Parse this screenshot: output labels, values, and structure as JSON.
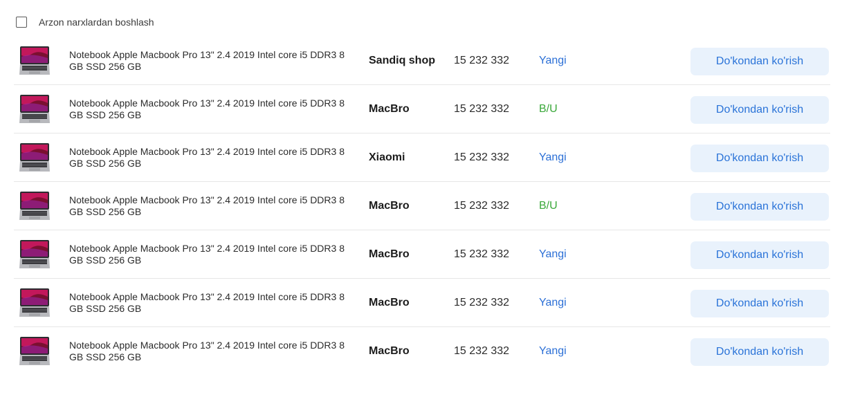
{
  "filter": {
    "label": "Arzon narxlardan boshlash",
    "checked": false
  },
  "colors": {
    "new_condition": "#2b6fd6",
    "used_condition": "#3aa83a",
    "button_bg": "#e9f2fc",
    "button_text": "#2a73d8",
    "divider": "#e6e6e6"
  },
  "offers": [
    {
      "image": "laptop-icon",
      "title": "Notebook Apple Macbook Pro 13\" 2.4 2019 Intel core i5 DDR3 8 GB SSD 256 GB",
      "shop": "Sandiq shop",
      "price": "15 232 332",
      "condition": "Yangi",
      "condition_type": "new",
      "button_label": "Do'kondan ko'rish"
    },
    {
      "image": "laptop-icon",
      "title": "Notebook Apple Macbook Pro 13\" 2.4 2019 Intel core i5 DDR3 8 GB SSD 256 GB",
      "shop": "MacBro",
      "price": "15 232 332",
      "condition": "B/U",
      "condition_type": "used",
      "button_label": "Do'kondan ko'rish"
    },
    {
      "image": "laptop-icon",
      "title": "Notebook Apple Macbook Pro 13\" 2.4 2019 Intel core i5 DDR3 8 GB SSD 256 GB",
      "shop": "Xiaomi",
      "price": "15 232 332",
      "condition": "Yangi",
      "condition_type": "new",
      "button_label": "Do'kondan ko'rish"
    },
    {
      "image": "laptop-icon",
      "title": "Notebook Apple Macbook Pro 13\" 2.4 2019 Intel core i5 DDR3 8 GB SSD 256 GB",
      "shop": "MacBro",
      "price": "15 232 332",
      "condition": "B/U",
      "condition_type": "used",
      "button_label": "Do'kondan ko'rish"
    },
    {
      "image": "laptop-icon",
      "title": "Notebook Apple Macbook Pro 13\" 2.4 2019 Intel core i5 DDR3 8 GB SSD 256 GB",
      "shop": "MacBro",
      "price": "15 232 332",
      "condition": "Yangi",
      "condition_type": "new",
      "button_label": "Do'kondan ko'rish"
    },
    {
      "image": "laptop-icon",
      "title": "Notebook Apple Macbook Pro 13\" 2.4 2019 Intel core i5 DDR3 8 GB SSD 256 GB",
      "shop": "MacBro",
      "price": "15 232 332",
      "condition": "Yangi",
      "condition_type": "new",
      "button_label": "Do'kondan ko'rish"
    },
    {
      "image": "laptop-icon",
      "title": "Notebook Apple Macbook Pro 13\" 2.4 2019 Intel core i5 DDR3 8 GB SSD 256 GB",
      "shop": "MacBro",
      "price": "15 232 332",
      "condition": "Yangi",
      "condition_type": "new",
      "button_label": "Do'kondan ko'rish"
    }
  ]
}
